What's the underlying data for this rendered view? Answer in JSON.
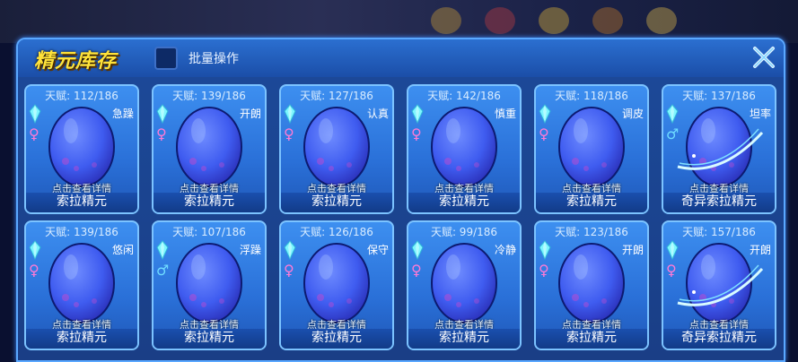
{
  "window": {
    "title": "精元库存",
    "batch_label": "批量操作"
  },
  "cards": [
    {
      "talent": "天赋: 112/186",
      "nature": "急躁",
      "gender": "♀",
      "gender_type": "female",
      "detail": "点击查看详情",
      "name": "索拉精元",
      "shiny": false
    },
    {
      "talent": "天赋: 139/186",
      "nature": "开朗",
      "gender": "♀",
      "gender_type": "female",
      "detail": "点击查看详情",
      "name": "索拉精元",
      "shiny": false
    },
    {
      "talent": "天赋: 127/186",
      "nature": "认真",
      "gender": "♀",
      "gender_type": "female",
      "detail": "点击查看详情",
      "name": "索拉精元",
      "shiny": false
    },
    {
      "talent": "天赋: 142/186",
      "nature": "慎重",
      "gender": "♀",
      "gender_type": "female",
      "detail": "点击查看详情",
      "name": "索拉精元",
      "shiny": false
    },
    {
      "talent": "天赋: 118/186",
      "nature": "调皮",
      "gender": "♀",
      "gender_type": "female",
      "detail": "点击查看详情",
      "name": "索拉精元",
      "shiny": false
    },
    {
      "talent": "天赋: 137/186",
      "nature": "坦率",
      "gender": "♂",
      "gender_type": "male",
      "detail": "点击查看详情",
      "name": "奇异索拉精元",
      "shiny": true
    },
    {
      "talent": "天赋: 139/186",
      "nature": "悠闲",
      "gender": "♀",
      "gender_type": "female",
      "detail": "点击查看详情",
      "name": "索拉精元",
      "shiny": false
    },
    {
      "talent": "天赋: 107/186",
      "nature": "浮躁",
      "gender": "♂",
      "gender_type": "male",
      "detail": "点击查看详情",
      "name": "索拉精元",
      "shiny": false
    },
    {
      "talent": "天赋: 126/186",
      "nature": "保守",
      "gender": "♀",
      "gender_type": "female",
      "detail": "点击查看详情",
      "name": "索拉精元",
      "shiny": false
    },
    {
      "talent": "天赋: 99/186",
      "nature": "冷静",
      "gender": "♀",
      "gender_type": "female",
      "detail": "点击查看详情",
      "name": "索拉精元",
      "shiny": false
    },
    {
      "talent": "天赋: 123/186",
      "nature": "开朗",
      "gender": "♀",
      "gender_type": "female",
      "detail": "点击查看详情",
      "name": "索拉精元",
      "shiny": false
    },
    {
      "talent": "天赋: 157/186",
      "nature": "开朗",
      "gender": "♀",
      "gender_type": "female",
      "detail": "点击查看详情",
      "name": "奇异索拉精元",
      "shiny": true
    }
  ],
  "colors": {
    "accent": "#ffe23a",
    "panel": "#1c4a9a",
    "card_border": "#7cc3ff",
    "egg": "#3f5cf0"
  },
  "icons": {
    "close": "close-icon",
    "crystal": "crystal-icon",
    "egg": "egg-icon"
  }
}
